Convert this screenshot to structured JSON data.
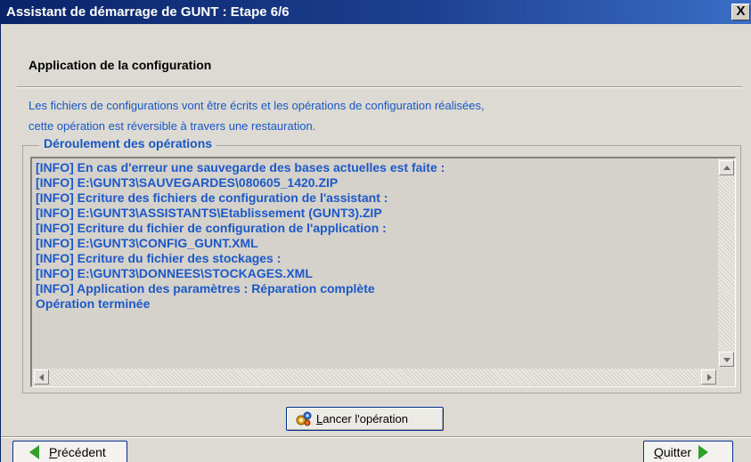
{
  "window": {
    "title": "Assistant de démarrage de GUNT : Etape 6/6",
    "close_label": "X"
  },
  "header": {
    "step_title": "Application de la configuration"
  },
  "description": {
    "line1": "Les fichiers de configurations vont être écrits et les opérations de configuration réalisées,",
    "line2": "cette opération est réversible à travers une restauration."
  },
  "operations": {
    "group_label": "Déroulement des opérations",
    "log": [
      "[INFO] En cas d'erreur une sauvegarde des bases actuelles est faite :",
      "[INFO] E:\\GUNT3\\SAUVEGARDES\\080605_1420.ZIP",
      "[INFO] Ecriture des fichiers de configuration de l'assistant :",
      "[INFO] E:\\GUNT3\\ASSISTANTS\\Etablissement (GUNT3).ZIP",
      "[INFO] Ecriture du fichier de configuration de l'application :",
      "[INFO] E:\\GUNT3\\CONFIG_GUNT.XML",
      "[INFO] Ecriture du fichier des stockages :",
      "[INFO] E:\\GUNT3\\DONNEES\\STOCKAGES.XML",
      "[INFO] Application des paramètres : Réparation complète",
      "Opération terminée"
    ]
  },
  "buttons": {
    "launch_first": "L",
    "launch_rest": "ancer l'opération",
    "previous_first": "P",
    "previous_rest": "récédent",
    "quit_first": "Q",
    "quit_rest": "uitter"
  },
  "colors": {
    "accent_text": "#1d58c8",
    "title_bar": "#0a246a",
    "nav_arrow": "#2ea12a"
  },
  "icons": {
    "launch": "gear-icon",
    "previous": "green-arrow-left-icon",
    "next": "green-arrow-right-icon"
  }
}
